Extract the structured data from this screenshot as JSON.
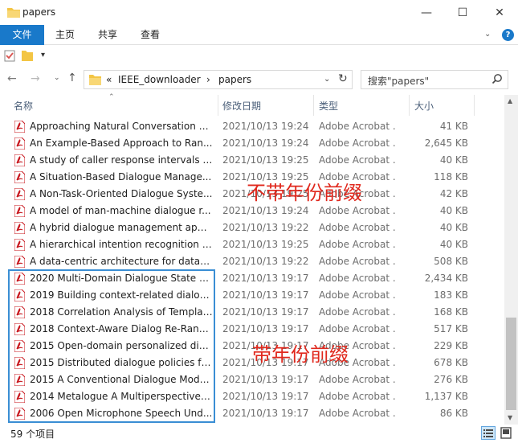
{
  "window": {
    "title": "papers",
    "min_glyph": "—",
    "max_glyph": "☐",
    "close_glyph": "✕"
  },
  "ribbon": {
    "tabs": [
      {
        "label": "文件",
        "active": true
      },
      {
        "label": "主页"
      },
      {
        "label": "共享"
      },
      {
        "label": "查看"
      }
    ],
    "expand_glyph": "⌄",
    "help_glyph": "?"
  },
  "quick_access": {
    "dropdown_glyph": "▾"
  },
  "nav": {
    "back_glyph": "←",
    "forward_glyph": "→",
    "recent_glyph": "⌄",
    "up_glyph": "↑",
    "breadcrumb": {
      "prefix": "«",
      "segments": [
        "IEEE_downloader",
        "papers"
      ],
      "separator": "›"
    },
    "dropdown_glyph": "⌄",
    "refresh_glyph": "↻"
  },
  "search": {
    "placeholder": "搜索\"papers\""
  },
  "columns": {
    "name": "名称",
    "date": "修改日期",
    "type": "类型",
    "size": "大小",
    "sort_glyph": "⌃"
  },
  "files": [
    {
      "name": "Approaching Natural Conversation C...",
      "date": "2021/10/13 19:24",
      "type": "Adobe Acrobat ...",
      "size": "41 KB"
    },
    {
      "name": "An Example-Based Approach to Ran...",
      "date": "2021/10/13 19:24",
      "type": "Adobe Acrobat ...",
      "size": "2,645 KB"
    },
    {
      "name": "A study of caller response intervals i...",
      "date": "2021/10/13 19:25",
      "type": "Adobe Acrobat ...",
      "size": "40 KB"
    },
    {
      "name": "A Situation-Based Dialogue Manage...",
      "date": "2021/10/13 19:25",
      "type": "Adobe Acrobat ...",
      "size": "118 KB"
    },
    {
      "name": "A Non-Task-Oriented Dialogue Syste...",
      "date": "2021/10/13 19:25",
      "type": "Adobe Acrobat ...",
      "size": "42 KB"
    },
    {
      "name": "A model of man-machine dialogue r...",
      "date": "2021/10/13 19:24",
      "type": "Adobe Acrobat ...",
      "size": "40 KB"
    },
    {
      "name": "A hybrid dialogue management appr...",
      "date": "2021/10/13 19:22",
      "type": "Adobe Acrobat ...",
      "size": "40 KB"
    },
    {
      "name": "A hierarchical intention recognition m...",
      "date": "2021/10/13 19:25",
      "type": "Adobe Acrobat ...",
      "size": "40 KB"
    },
    {
      "name": "A data-centric architecture for data-d...",
      "date": "2021/10/13 19:22",
      "type": "Adobe Acrobat ...",
      "size": "508 KB"
    },
    {
      "name": "2020 Multi-Domain Dialogue State Tr...",
      "date": "2021/10/13 19:17",
      "type": "Adobe Acrobat ...",
      "size": "2,434 KB"
    },
    {
      "name": "2019 Building context-related dialog...",
      "date": "2021/10/13 19:17",
      "type": "Adobe Acrobat ...",
      "size": "183 KB"
    },
    {
      "name": "2018 Correlation Analysis of Templat...",
      "date": "2021/10/13 19:17",
      "type": "Adobe Acrobat ...",
      "size": "168 KB"
    },
    {
      "name": "2018 Context-Aware Dialog Re-Ranki...",
      "date": "2021/10/13 19:17",
      "type": "Adobe Acrobat ...",
      "size": "517 KB"
    },
    {
      "name": "2015 Open-domain personalized dial...",
      "date": "2021/10/13 19:17",
      "type": "Adobe Acrobat ...",
      "size": "229 KB"
    },
    {
      "name": "2015 Distributed dialogue policies fo...",
      "date": "2021/10/13 19:17",
      "type": "Adobe Acrobat ...",
      "size": "678 KB"
    },
    {
      "name": "2015 A Conventional Dialogue Model...",
      "date": "2021/10/13 19:17",
      "type": "Adobe Acrobat ...",
      "size": "276 KB"
    },
    {
      "name": "2014 Metalogue A Multiperspective ...",
      "date": "2021/10/13 19:17",
      "type": "Adobe Acrobat ...",
      "size": "1,137 KB"
    },
    {
      "name": "2006 Open Microphone Speech Und...",
      "date": "2021/10/13 19:17",
      "type": "Adobe Acrobat ...",
      "size": "86 KB"
    }
  ],
  "scrollbar": {
    "up_glyph": "▲",
    "down_glyph": "▼"
  },
  "annotations": {
    "without_year": "不带年份前缀",
    "with_year": "带年份前缀",
    "color": "#e0281d"
  },
  "status": {
    "item_count": "59 个项目"
  },
  "colors": {
    "accent": "#1979ca",
    "pdf_red": "#c8171e",
    "folder_yellow": "#f3c544",
    "selection_blue": "#3a8ed4"
  }
}
